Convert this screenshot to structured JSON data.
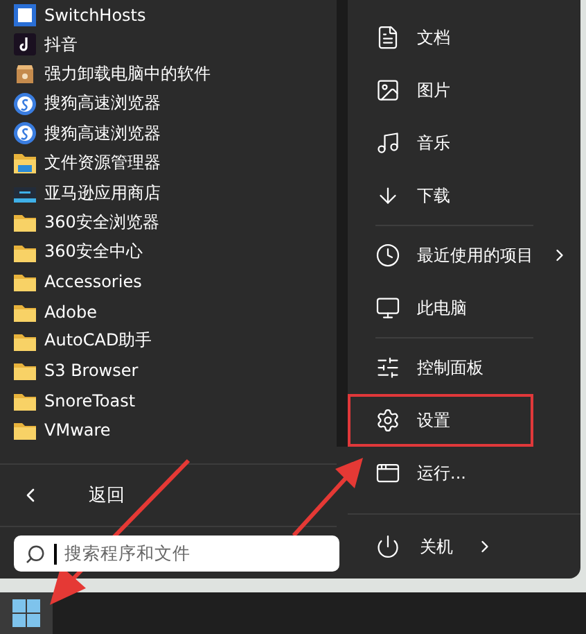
{
  "apps": [
    {
      "label": "SwitchHosts",
      "kind": "hosts"
    },
    {
      "label": "抖音",
      "kind": "note"
    },
    {
      "label": "强力卸载电脑中的软件",
      "kind": "box"
    },
    {
      "label": "搜狗高速浏览器",
      "kind": "browser"
    },
    {
      "label": "搜狗高速浏览器",
      "kind": "browser"
    },
    {
      "label": "文件资源管理器",
      "kind": "explorer"
    },
    {
      "label": "亚马逊应用商店",
      "kind": "store"
    },
    {
      "label": "360安全浏览器",
      "kind": "folder"
    },
    {
      "label": "360安全中心",
      "kind": "folder"
    },
    {
      "label": "Accessories",
      "kind": "folder"
    },
    {
      "label": "Adobe",
      "kind": "folder"
    },
    {
      "label": "AutoCAD助手",
      "kind": "folder"
    },
    {
      "label": "S3 Browser",
      "kind": "folder"
    },
    {
      "label": "SnoreToast",
      "kind": "folder"
    },
    {
      "label": "VMware",
      "kind": "folder"
    }
  ],
  "back": {
    "label": "返回"
  },
  "search": {
    "placeholder": "搜索程序和文件"
  },
  "places": [
    {
      "label": "文档",
      "kind": "document",
      "highlighted": false,
      "submenu": false
    },
    {
      "label": "图片",
      "kind": "pictures",
      "highlighted": false,
      "submenu": false
    },
    {
      "label": "音乐",
      "kind": "music",
      "highlighted": false,
      "submenu": false
    },
    {
      "label": "下载",
      "kind": "download",
      "highlighted": false,
      "submenu": false
    },
    {
      "kind": "divider"
    },
    {
      "label": "最近使用的项目",
      "kind": "recent",
      "highlighted": false,
      "submenu": true
    },
    {
      "label": "此电脑",
      "kind": "computer",
      "highlighted": false,
      "submenu": false
    },
    {
      "kind": "divider"
    },
    {
      "label": "控制面板",
      "kind": "control",
      "highlighted": false,
      "submenu": false
    },
    {
      "label": "设置",
      "kind": "settings",
      "highlighted": true,
      "submenu": false
    },
    {
      "label": "运行...",
      "kind": "run",
      "highlighted": false,
      "submenu": false
    }
  ],
  "power": {
    "label": "关机",
    "submenu": true
  }
}
